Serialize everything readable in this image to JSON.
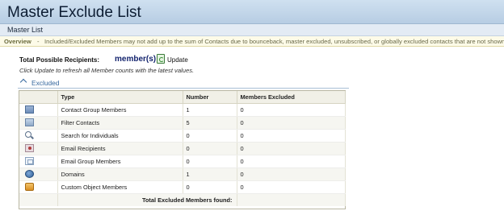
{
  "header": {
    "title": "Master Exclude List"
  },
  "subnav": {
    "crumb": "Master List"
  },
  "overview": {
    "label": "Overview",
    "separator": "-",
    "text": "Included/Excluded Members may not add up to the sum of Contacts due to bounceback, master excluded, unsubscribed, or globally excluded contacts that are not shown."
  },
  "recipients": {
    "label": "Total Possible Recipients:",
    "value": "member(s)",
    "update_label": "Update",
    "hint": "Click Update to refresh all Member counts with the latest values."
  },
  "section": {
    "label": "Excluded",
    "icon": "chevron-up-icon"
  },
  "table": {
    "columns": [
      "",
      "Type",
      "Number",
      "Members Excluded"
    ],
    "rows": [
      {
        "icon": "contact-group-icon",
        "type": "Contact Group Members",
        "number": "1",
        "excluded": "0"
      },
      {
        "icon": "filter-icon",
        "type": "Filter Contacts",
        "number": "5",
        "excluded": "0"
      },
      {
        "icon": "search-icon",
        "type": "Search for Individuals",
        "number": "0",
        "excluded": "0"
      },
      {
        "icon": "email-recipient-icon",
        "type": "Email Recipients",
        "number": "0",
        "excluded": "0"
      },
      {
        "icon": "email-group-icon",
        "type": "Email Group Members",
        "number": "0",
        "excluded": "0"
      },
      {
        "icon": "domain-globe-icon",
        "type": "Domains",
        "number": "1",
        "excluded": "0"
      },
      {
        "icon": "custom-object-icon",
        "type": "Custom Object Members",
        "number": "0",
        "excluded": "0"
      }
    ],
    "total_label": "Total Excluded Members found:",
    "total_value": ""
  },
  "colors": {
    "accent": "#36689e",
    "title_bar": "#c4d6ea",
    "overview_bg": "#fdfbe8"
  }
}
